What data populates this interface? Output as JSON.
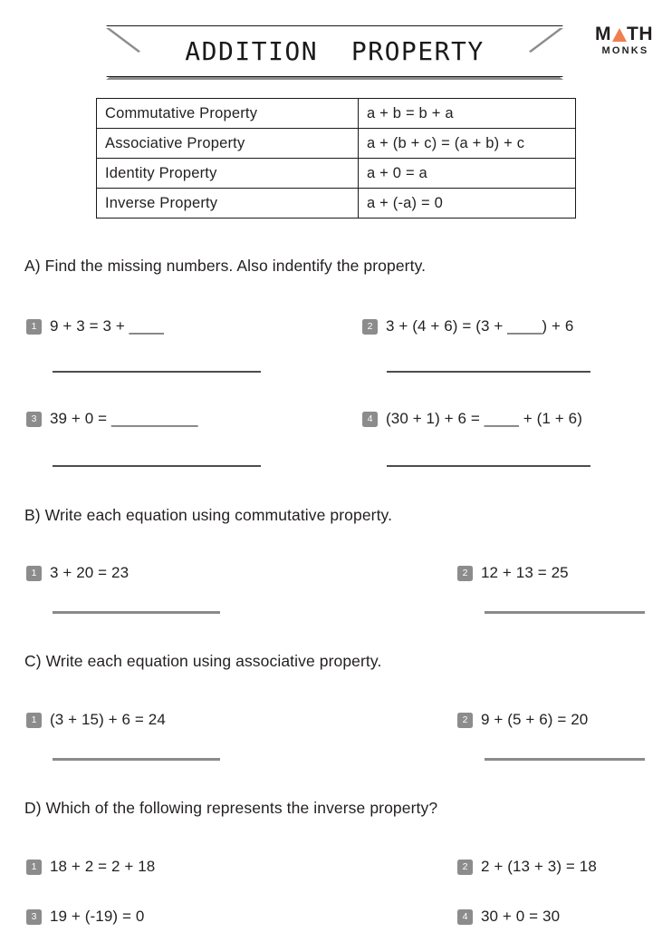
{
  "header": {
    "title": "ADDITION  PROPERTY",
    "logo": {
      "part1": "M",
      "part2": "TH",
      "subtitle": "MONKS",
      "accent_color": "#ef7f4f"
    }
  },
  "property_table": {
    "rows": [
      {
        "name": "Commutative Property",
        "formula": "a + b = b + a"
      },
      {
        "name": "Associative Property",
        "formula": "a + (b + c) = (a + b) + c"
      },
      {
        "name": "Identity Property",
        "formula": "a + 0 = a"
      },
      {
        "name": "Inverse Property",
        "formula": "a + (-a) = 0"
      }
    ]
  },
  "sections": [
    {
      "heading": "A) Find the missing numbers. Also indentify the property.",
      "questions": [
        {
          "num": "1",
          "text": "9 + 3 = 3 + ____"
        },
        {
          "num": "2",
          "text": "3 + (4 + 6) = (3 + ____) + 6"
        },
        {
          "num": "3",
          "text": "39 + 0 = __________"
        },
        {
          "num": "4",
          "text": "(30 + 1) + 6 = ____ + (1 + 6)"
        }
      ]
    },
    {
      "heading": "B) Write each equation using commutative property.",
      "questions": [
        {
          "num": "1",
          "text": "3 + 20 = 23"
        },
        {
          "num": "2",
          "text": "12 + 13 = 25"
        }
      ]
    },
    {
      "heading": "C) Write each equation using associative property.",
      "questions": [
        {
          "num": "1",
          "text": "(3 + 15) + 6 = 24"
        },
        {
          "num": "2",
          "text": "9 + (5 + 6) = 20"
        }
      ]
    },
    {
      "heading": "D) Which of the following represents the inverse property?",
      "questions": [
        {
          "num": "1",
          "text": "18 + 2 = 2 + 18"
        },
        {
          "num": "2",
          "text": "2 + (13 + 3) = 18"
        },
        {
          "num": "3",
          "text": "19 + (-19) = 0"
        },
        {
          "num": "4",
          "text": "30 + 0 = 30"
        }
      ]
    }
  ]
}
